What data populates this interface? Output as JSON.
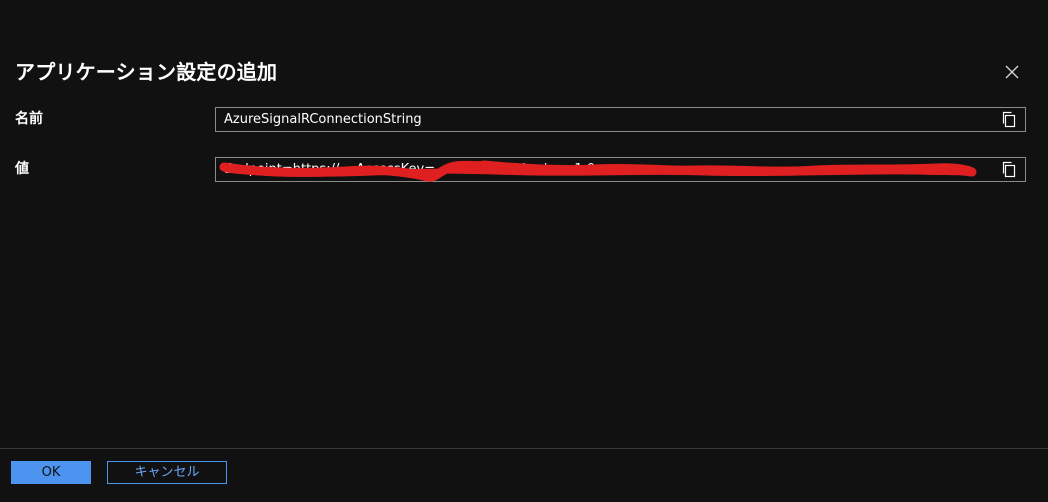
{
  "dialog": {
    "title": "アプリケーション設定の追加",
    "close_icon": "close-icon"
  },
  "fields": {
    "name": {
      "label": "名前",
      "value": "AzureSignalRConnectionString",
      "copy_icon": "copy-icon"
    },
    "value": {
      "label": "値",
      "value": "Endpoint=https://...;AccessKey=...Dfde%4...;Version=1.0;",
      "redacted": true,
      "copy_icon": "copy-icon"
    }
  },
  "footer": {
    "ok_label": "OK",
    "cancel_label": "キャンセル"
  },
  "colors": {
    "background": "#111111",
    "accent": "#4d94f0",
    "border": "#8a8a8a",
    "redaction": "#e02020"
  }
}
